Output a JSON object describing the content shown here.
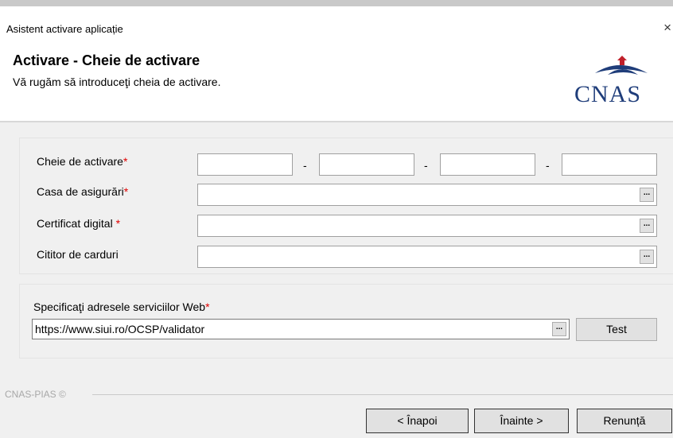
{
  "window": {
    "title": "Asistent activare aplicație",
    "close": "×"
  },
  "header": {
    "title": "Activare - Cheie de activare",
    "subtitle": "Vă rugăm să introduceţi cheia de activare.",
    "logo_text": "CNAS"
  },
  "form": {
    "key_label": "Cheie de activare",
    "key_parts": [
      "",
      "",
      "",
      ""
    ],
    "key_separator": "-",
    "insurance_label": "Casa de asigurări",
    "insurance_value": "",
    "certificate_label": "Certificat digital ",
    "certificate_value": "",
    "reader_label": "Cititor de carduri",
    "reader_value": "",
    "required_mark": "*",
    "browse_label": "..."
  },
  "web_services": {
    "label": "Specificaţi adresele serviciilor Web",
    "url": "https://www.siui.ro/OCSP/validator",
    "test_button": "Test"
  },
  "footer": {
    "brand": "CNAS-PIAS ©",
    "back_button": "< Înapoi",
    "next_button": "Înainte >",
    "cancel_button": "Renunță"
  },
  "colors": {
    "required": "#e00000",
    "logo": "#1f3d7a",
    "logo_arc": "#c0202a"
  },
  "icons": {
    "close": "close-icon",
    "browse": "ellipsis-icon",
    "logo": "cnas-logo"
  }
}
